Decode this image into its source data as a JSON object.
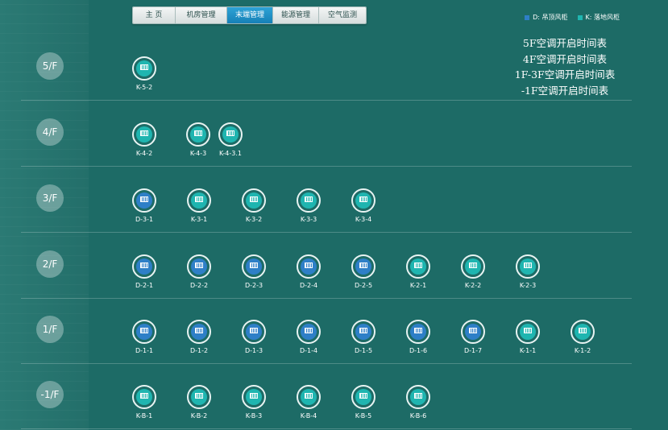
{
  "nav": {
    "tabs": [
      "主 页",
      "机房管理",
      "末端管理",
      "能源管理",
      "空气监测"
    ],
    "active": 2
  },
  "legend": [
    {
      "label": "D: 吊顶风柜",
      "color": "#2e7fc7"
    },
    {
      "label": "K: 落地风柜",
      "color": "#1fb5b0"
    }
  ],
  "schedule_links": [
    "5F空调开启时间表",
    "4F空调开启时间表",
    "1F-3F空调开启时间表",
    "-1F空调开启时间表"
  ],
  "floors": [
    {
      "name": "5/F",
      "units": [
        "K-5-2"
      ]
    },
    {
      "name": "4/F",
      "units": [
        "K-4-2",
        "K-4-3",
        "K-4-3.1"
      ]
    },
    {
      "name": "3/F",
      "units": [
        "D-3-1",
        "K-3-1",
        "K-3-2",
        "K-3-3",
        "K-3-4"
      ]
    },
    {
      "name": "2/F",
      "units": [
        "D-2-1",
        "D-2-2",
        "D-2-3",
        "D-2-4",
        "D-2-5",
        "K-2-1",
        "K-2-2",
        "K-2-3"
      ]
    },
    {
      "name": "1/F",
      "units": [
        "D-1-1",
        "D-1-2",
        "D-1-3",
        "D-1-4",
        "D-1-5",
        "D-1-6",
        "D-1-7",
        "K-1-1",
        "K-1-2"
      ]
    },
    {
      "name": "-1/F",
      "units": [
        "K-B-1",
        "K-B-2",
        "K-B-3",
        "K-B-4",
        "K-B-5",
        "K-B-6"
      ]
    }
  ]
}
